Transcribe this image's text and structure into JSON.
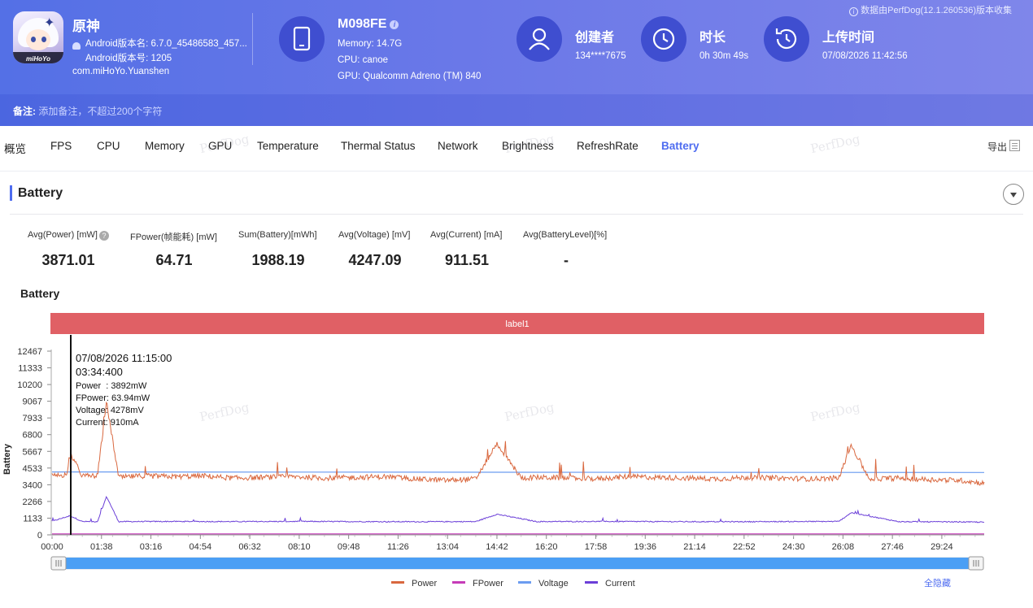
{
  "header": {
    "data_source": "数据由PerfDog(12.1.260536)版本收集",
    "app": {
      "name": "原神",
      "version_name": "Android版本名: 6.7.0_45486583_457...",
      "version_code": "Android版本号: 1205",
      "package": "com.miHoYo.Yuanshen",
      "icon_logo": "miHoYo"
    },
    "device": {
      "name": "M098FE",
      "memory": "Memory: 14.7G",
      "cpu": "CPU: canoe",
      "gpu": "GPU: Qualcomm Adreno (TM) 840"
    },
    "creator": {
      "title": "创建者",
      "value": "134****7675"
    },
    "duration": {
      "title": "时长",
      "value": "0h 30m 49s"
    },
    "upload": {
      "title": "上传时间",
      "value": "07/08/2026 11:42:56"
    },
    "note_label": "备注:",
    "note_placeholder": "添加备注，不超过200个字符"
  },
  "tabs": [
    "概览",
    "FPS",
    "CPU",
    "Memory",
    "GPU",
    "Temperature",
    "Thermal Status",
    "Network",
    "Brightness",
    "RefreshRate",
    "Battery"
  ],
  "active_tab": "Battery",
  "export_label": "导出",
  "section": {
    "title": "Battery",
    "metrics": [
      {
        "label": "Avg(Power) [mW]",
        "value": "3871.01"
      },
      {
        "label": "FPower(帧能耗) [mW]",
        "value": "64.71"
      },
      {
        "label": "Sum(Battery)[mWh]",
        "value": "1988.19"
      },
      {
        "label": "Avg(Voltage) [mV]",
        "value": "4247.09"
      },
      {
        "label": "Avg(Current) [mA]",
        "value": "911.51"
      },
      {
        "label": "Avg(BatteryLevel)[%]",
        "value": "-"
      }
    ]
  },
  "watermark": "PerfDog",
  "chart_data": {
    "type": "line",
    "title": "Battery",
    "ylabel": "Battery",
    "label_band": "label1",
    "yticks": [
      "0",
      "1133",
      "2266",
      "3400",
      "4533",
      "5667",
      "6800",
      "7933",
      "9067",
      "10200",
      "11333",
      "12467"
    ],
    "ylim": [
      0,
      12467
    ],
    "xticks": [
      "00:00",
      "01:38",
      "03:16",
      "04:54",
      "06:32",
      "08:10",
      "09:48",
      "11:26",
      "13:04",
      "14:42",
      "16:20",
      "17:58",
      "19:36",
      "21:14",
      "22:52",
      "24:30",
      "26:08",
      "27:46",
      "29:24"
    ],
    "x_range_minutes": [
      0,
      30.8
    ],
    "series": [
      {
        "name": "Power",
        "color": "#d9683f",
        "x_minutes": [
          0,
          0.5,
          0.6,
          1.0,
          1.5,
          1.8,
          2.2,
          3.0,
          4.0,
          5.0,
          6.0,
          7.0,
          8.0,
          9.0,
          10.0,
          11.0,
          12.0,
          13.0,
          14.0,
          14.7,
          15.5,
          16.0,
          17.0,
          18.0,
          19.0,
          20.0,
          21.0,
          22.0,
          23.0,
          24.0,
          25.0,
          26.0,
          26.4,
          27.0,
          28.0,
          29.0,
          30.0,
          30.8
        ],
        "values": [
          4000,
          4100,
          5500,
          4000,
          4000,
          9000,
          3900,
          4000,
          3950,
          4000,
          3850,
          3900,
          3950,
          3850,
          3900,
          3950,
          3800,
          3700,
          3800,
          6200,
          3850,
          3900,
          3850,
          3800,
          3950,
          3900,
          3850,
          3800,
          3900,
          3850,
          3800,
          3850,
          6100,
          3800,
          3850,
          3750,
          3700,
          3500
        ]
      },
      {
        "name": "FPower",
        "color": "#c63cb8",
        "x_minutes": [
          0,
          30.8
        ],
        "values": [
          65,
          65
        ]
      },
      {
        "name": "Voltage",
        "color": "#6b9cf0",
        "x_minutes": [
          0,
          30.8
        ],
        "values": [
          4270,
          4230
        ]
      },
      {
        "name": "Current",
        "color": "#6b3fd8",
        "x_minutes": [
          0,
          0.6,
          1.0,
          1.5,
          1.8,
          2.2,
          4,
          6,
          8,
          10,
          12,
          14,
          14.7,
          16,
          18,
          20,
          22,
          24,
          26,
          26.4,
          28,
          30,
          30.8
        ],
        "values": [
          920,
          1300,
          900,
          900,
          2600,
          900,
          910,
          900,
          910,
          900,
          890,
          900,
          1400,
          900,
          910,
          900,
          890,
          900,
          910,
          1500,
          890,
          880,
          860
        ]
      }
    ],
    "tooltip": {
      "date": "07/08/2026 11:15:00",
      "time": "03:34:400",
      "lines": [
        "Power  : 3892mW",
        "FPower: 63.94mW",
        "Voltage: 4278mV",
        "Current: 910mA"
      ]
    },
    "legend": [
      "Power",
      "FPower",
      "Voltage",
      "Current"
    ],
    "legend_placement": "bottom",
    "hide_all_label": "全隐藏"
  }
}
